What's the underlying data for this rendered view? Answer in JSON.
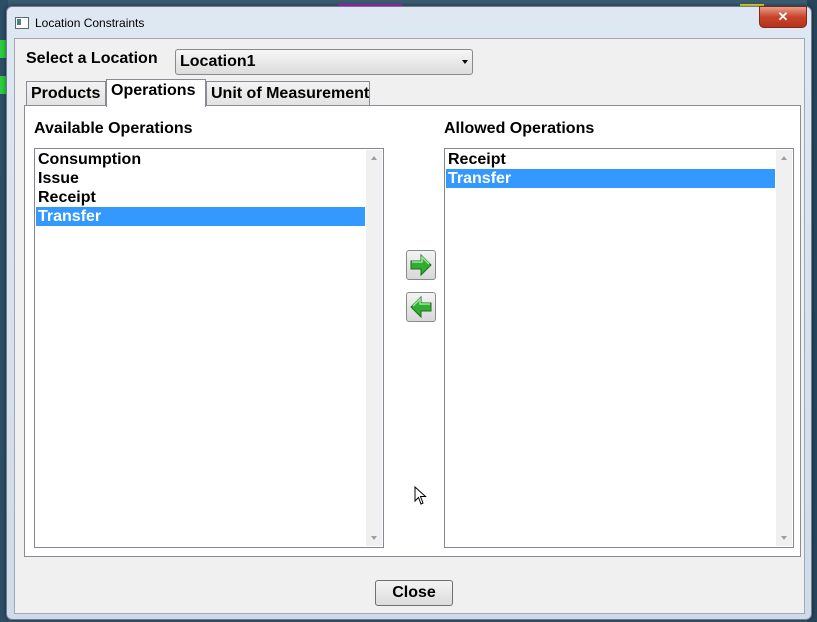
{
  "window": {
    "title": "Location Constraints",
    "close_glyph": "✕"
  },
  "location": {
    "label": "Select a Location",
    "selected": "Location1"
  },
  "tabs": [
    {
      "label": "Products"
    },
    {
      "label": "Operations"
    },
    {
      "label": "Unit of Measurement"
    }
  ],
  "active_tab": "Operations",
  "available": {
    "label": "Available Operations",
    "items": [
      "Consumption",
      "Issue",
      "Receipt",
      "Transfer"
    ],
    "selected": "Transfer"
  },
  "allowed": {
    "label": "Allowed Operations",
    "items": [
      "Receipt",
      "Transfer"
    ],
    "selected": "Transfer"
  },
  "buttons": {
    "close": "Close"
  },
  "icons": {
    "add": "arrow-right-icon",
    "remove": "arrow-left-icon",
    "accent": "#3399ff",
    "arrow_green": "#2fae2f"
  }
}
